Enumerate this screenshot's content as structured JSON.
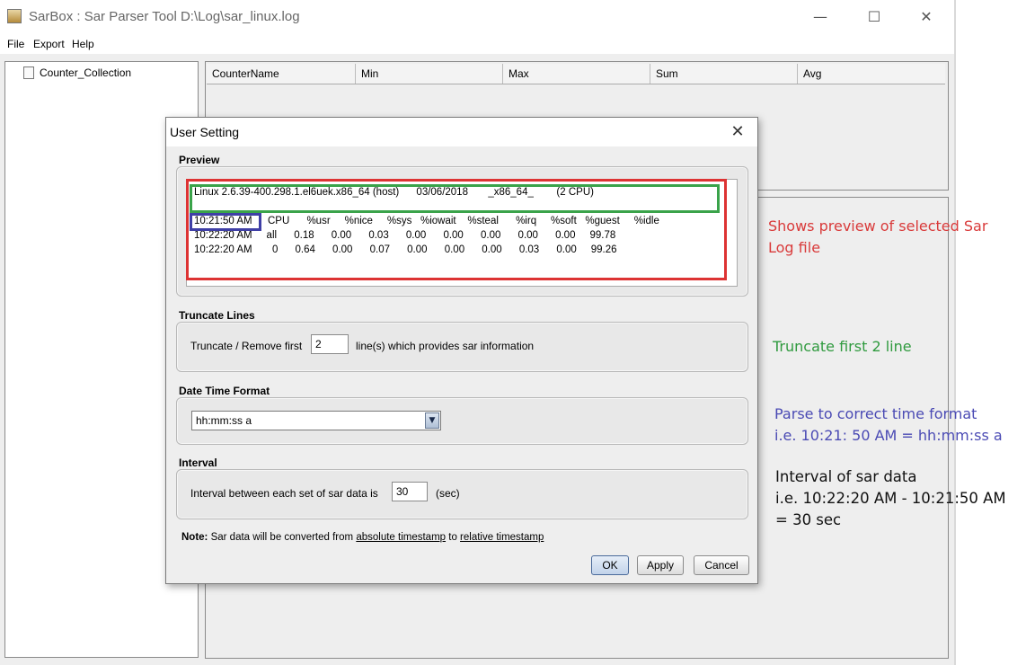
{
  "window": {
    "title": "SarBox : Sar Parser Tool D:\\Log\\sar_linux.log",
    "minimize_glyph": "—",
    "maximize_glyph": "☐",
    "close_glyph": "✕"
  },
  "menu": {
    "items": [
      "File",
      "Export",
      "Help"
    ]
  },
  "tree": {
    "root_label": "Counter_Collection"
  },
  "table": {
    "columns": [
      "CounterName",
      "Min",
      "Max",
      "Sum",
      "Avg"
    ]
  },
  "dialog": {
    "title": "User Setting",
    "close_glyph": "✕",
    "preview": {
      "label": "Preview",
      "header_line": "Linux 2.6.39-400.298.1.el6uek.x86_64 (host)      03/06/2018       _x86_64_        (2 CPU)",
      "column_time": "10:21:50 AM",
      "column_headers": "CPU      %usr     %nice     %sys   %iowait    %steal      %irq     %soft   %guest     %idle",
      "rows": [
        "10:22:20 AM     all      0.18      0.00      0.03      0.00      0.00      0.00      0.00      0.00     99.78",
        "10:22:20 AM       0      0.64      0.00      0.07      0.00      0.00      0.00      0.03      0.00     99.26"
      ]
    },
    "truncate": {
      "label": "Truncate Lines",
      "prefix": "Truncate / Remove first",
      "value": "2",
      "suffix": "line(s) which provides sar information"
    },
    "datetime": {
      "label": "Date Time Format",
      "value": "hh:mm:ss a",
      "arrow_glyph": "▼"
    },
    "interval": {
      "label": "Interval",
      "prefix": "Interval between each set of sar data is",
      "value": "30",
      "suffix": "(sec)"
    },
    "note": {
      "bold": "Note:",
      "text1": "Sar data will be converted from",
      "link1": "absolute timestamp",
      "text2": "to",
      "link2": "relative timestamp"
    },
    "buttons": {
      "ok": "OK",
      "apply": "Apply",
      "cancel": "Cancel"
    }
  },
  "annotations": {
    "preview": [
      "Shows preview of selected Sar",
      "Log file"
    ],
    "truncate": "Truncate first 2 line",
    "format": [
      "Parse to correct time format",
      "i.e. 10:21: 50 AM = hh:mm:ss a"
    ],
    "interval": [
      "Interval of sar data",
      "i.e. 10:22:20 AM - 10:21:50 AM",
      "= 30 sec"
    ]
  },
  "colors": {
    "annotation_red": "#d93a3a",
    "annotation_green": "#2f9a3e",
    "annotation_blue": "#4a4ab4",
    "annotation_black": "#111111"
  }
}
